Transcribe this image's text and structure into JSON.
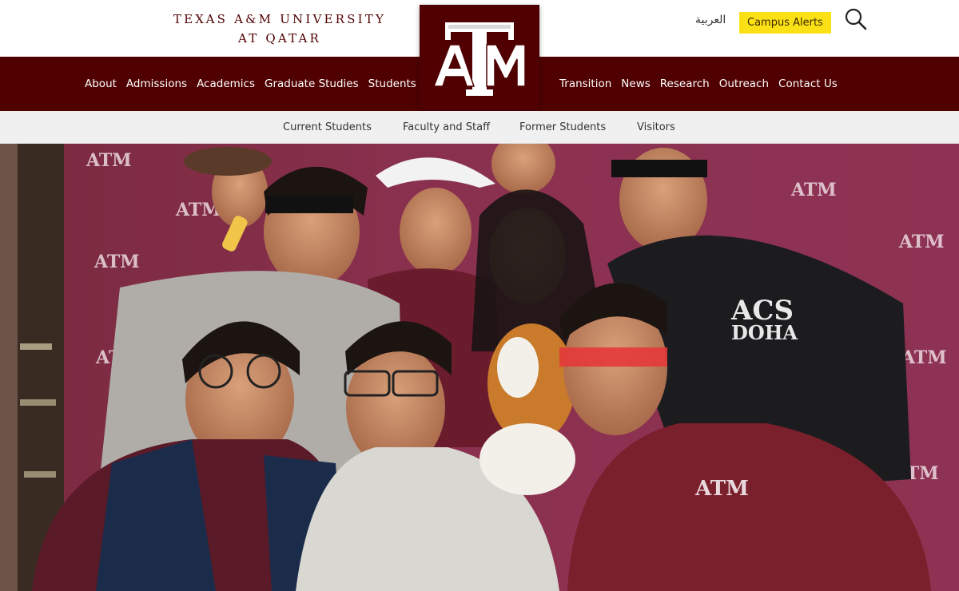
{
  "header": {
    "wordmark_line1": "TEXAS A&M UNIVERSITY",
    "wordmark_line2": "AT QATAR",
    "arabic_link": "العربية",
    "alerts_button": "Campus Alerts",
    "search_icon": "search-icon",
    "logo_icon": "atm-logo"
  },
  "nav": {
    "left": [
      "About",
      "Admissions",
      "Academics",
      "Graduate Studies",
      "Students"
    ],
    "right": [
      "Transition",
      "News",
      "Research",
      "Outreach",
      "Contact Us"
    ]
  },
  "subnav": [
    "Current Students",
    "Faculty and Staff",
    "Former Students",
    "Visitors"
  ],
  "hero": {
    "description_icon": "student-group-photo",
    "sweatshirt_text": "ACS DOHA",
    "backdrop_brand": "TEXAS A&M"
  },
  "colors": {
    "maroon": "#500000",
    "alert_yellow": "#fce016",
    "subnav_bg": "#f0f0f0"
  }
}
